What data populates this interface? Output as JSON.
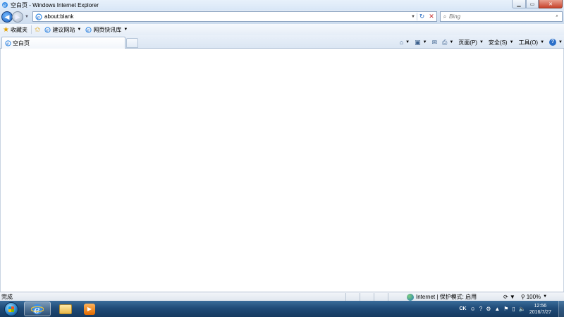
{
  "window": {
    "title": "空白页 - Windows Internet Explorer",
    "minimize_icon": "minimize-icon",
    "maximize_icon": "maximize-icon",
    "close_icon": "close-icon"
  },
  "navigation": {
    "back_icon": "back-arrow-icon",
    "forward_icon": "forward-arrow-icon",
    "address_url": "about:blank",
    "search_placeholder": "Bing"
  },
  "favorites_bar": {
    "favorites_label": "收藏夹",
    "links": [
      {
        "label": "建议网站"
      },
      {
        "label": "网页快讯库"
      }
    ]
  },
  "tabs": [
    {
      "label": "空白页",
      "active": true
    }
  ],
  "command_bar": {
    "page_label": "页面(P)",
    "safety_label": "安全(S)",
    "tools_label": "工具(O)"
  },
  "status_bar": {
    "status_text": "完成",
    "zone_text": "Internet | 保护模式: 启用",
    "zoom_text": "100%"
  },
  "taskbar": {
    "apps": [
      "internet-explorer",
      "windows-explorer",
      "media-player"
    ],
    "tray": {
      "language": "CK",
      "time": "12:56",
      "date": "2016/7/27"
    }
  },
  "colors": {
    "chrome_blue": "#dbe6f3",
    "close_red": "#c7432c",
    "taskbar": "#1f4b78"
  }
}
